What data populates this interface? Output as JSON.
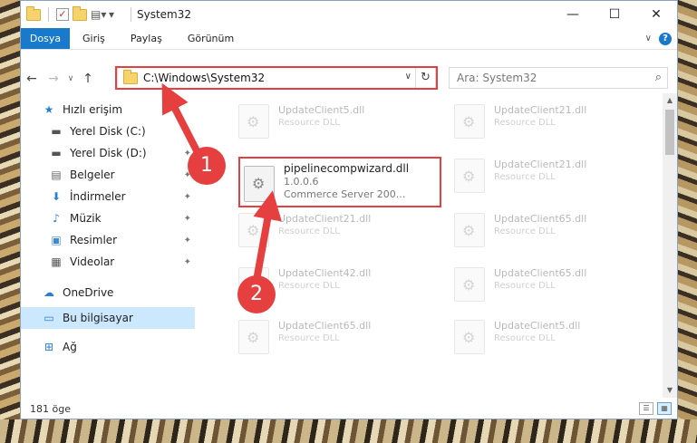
{
  "window": {
    "title": "System32",
    "minimize": "—",
    "maximize": "☐",
    "close": "✕"
  },
  "ribbon": {
    "tabs": [
      "Dosya",
      "Giriş",
      "Paylaş",
      "Görünüm"
    ],
    "expand": "∨",
    "help": "?"
  },
  "nav": {
    "back": "←",
    "forward": "→",
    "recent": "∨",
    "up": "↑",
    "address": "C:\\Windows\\System32",
    "address_dropdown": "∨",
    "refresh": "↻",
    "search_placeholder": "Ara: System32",
    "search_icon": "⌕"
  },
  "sidebar": {
    "items": [
      {
        "label": "Hızlı erişim",
        "icon": "star-icon",
        "glyph": "★",
        "pinned": false
      },
      {
        "label": "Yerel Disk (C:)",
        "icon": "disk-icon",
        "glyph": "▬",
        "pinned": true
      },
      {
        "label": "Yerel Disk (D:)",
        "icon": "disk-icon",
        "glyph": "▬",
        "pinned": true
      },
      {
        "label": "Belgeler",
        "icon": "documents-icon",
        "glyph": "▤",
        "pinned": true
      },
      {
        "label": "İndirmeler",
        "icon": "download-icon",
        "glyph": "⬇",
        "pinned": true
      },
      {
        "label": "Müzik",
        "icon": "music-icon",
        "glyph": "♪",
        "pinned": true
      },
      {
        "label": "Resimler",
        "icon": "pictures-icon",
        "glyph": "▣",
        "pinned": true
      },
      {
        "label": "Videolar",
        "icon": "video-icon",
        "glyph": "▦",
        "pinned": true
      },
      {
        "label": "OneDrive",
        "icon": "cloud-icon",
        "glyph": "☁",
        "pinned": false
      },
      {
        "label": "Bu bilgisayar",
        "icon": "computer-icon",
        "glyph": "▭",
        "pinned": false,
        "selected": true
      },
      {
        "label": "Ağ",
        "icon": "network-icon",
        "glyph": "⊞",
        "pinned": false
      }
    ],
    "pin_glyph": "📌"
  },
  "files": {
    "left": [
      {
        "name": "UpdateClient5.dll",
        "desc": "Resource DLL"
      },
      {
        "name": "UpdateClient21.dll",
        "desc": "Resource DLL"
      },
      {
        "name": "UpdateClient42.dll",
        "desc": "Resource DLL"
      },
      {
        "name": "UpdateClient65.dll",
        "desc": "Resource DLL"
      }
    ],
    "right": [
      {
        "name": "UpdateClient21.dll",
        "desc": "Resource DLL"
      },
      {
        "name": "UpdateClient21.dll",
        "desc": "Resource DLL"
      },
      {
        "name": "UpdateClient65.dll",
        "desc": "Resource DLL"
      },
      {
        "name": "UpdateClient65.dll",
        "desc": "Resource DLL"
      },
      {
        "name": "UpdateClient5.dll",
        "desc": "Resource DLL"
      }
    ],
    "featured": {
      "name": "pipelinecompwizard.dll",
      "version": "1.0.0.6",
      "company": "Commerce Server 200..."
    }
  },
  "status": {
    "count": "181 öge"
  },
  "annotations": {
    "badge1": "1",
    "badge2": "2",
    "color": "#e5403f"
  }
}
